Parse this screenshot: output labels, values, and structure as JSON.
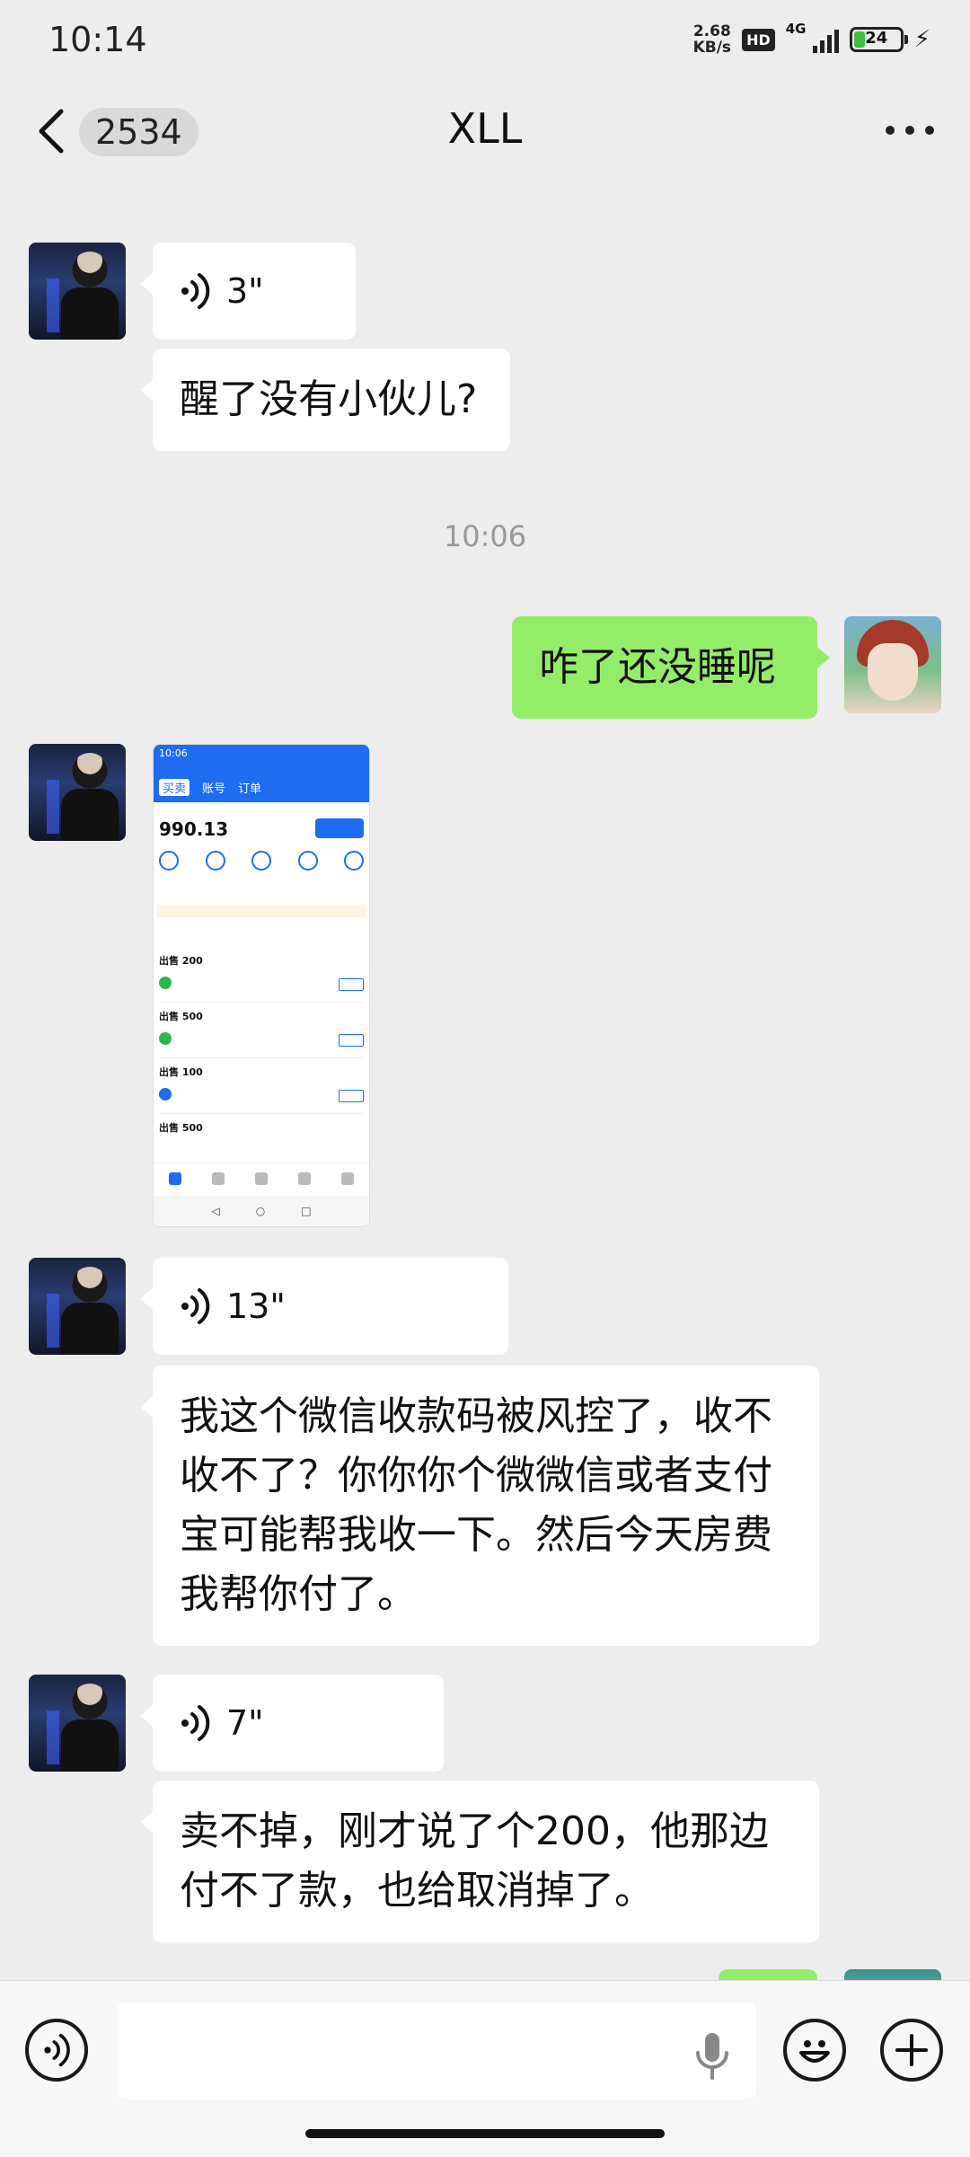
{
  "status_bar": {
    "time": "10:14",
    "net_speed_value": "2.68",
    "net_speed_unit": "KB/s",
    "hd_label": "HD",
    "network_type": "4G",
    "battery_percent": "24"
  },
  "nav": {
    "unread_count": "2534",
    "title": "XLL"
  },
  "messages": [
    {
      "side": "left",
      "type": "voice",
      "duration": "3\""
    },
    {
      "side": "left",
      "type": "text",
      "text": "醒了没有小伙儿?"
    },
    {
      "type": "timestamp",
      "text": "10:06"
    },
    {
      "side": "right",
      "type": "text",
      "text": "咋了还没睡呢"
    },
    {
      "side": "left",
      "type": "image",
      "image_content": {
        "status_time": "10:06",
        "tabs": [
          "买卖",
          "账号",
          "订单"
        ],
        "balance": "990.13",
        "rows": [
          {
            "amount": "出售 200",
            "status": "已取消"
          },
          {
            "amount": "出售 500",
            "status": "已取消"
          },
          {
            "amount": "出售 100",
            "status": "已取消"
          },
          {
            "amount": "出售 500",
            "status": ""
          }
        ]
      }
    },
    {
      "side": "left",
      "type": "voice",
      "duration": "13\""
    },
    {
      "side": "left",
      "type": "text",
      "text": "我这个微信收款码被风控了，收不收不了？你你你个微微信或者支付宝可能帮我收一下。然后今天房费我帮你付了。"
    },
    {
      "side": "left",
      "type": "voice",
      "duration": "7\""
    },
    {
      "side": "left",
      "type": "text",
      "text": "卖不掉，刚才说了个200，他那边付不了款，也给取消掉了。"
    }
  ],
  "input_bar": {
    "placeholder": ""
  },
  "colors": {
    "background": "#ededed",
    "outgoing_bubble": "#95ec69",
    "incoming_bubble": "#ffffff",
    "timestamp_text": "#999999"
  },
  "icons": [
    "back-arrow-icon",
    "more-icon",
    "voice-wave-icon",
    "microphone-icon",
    "emoji-icon",
    "plus-icon",
    "voice-toggle-icon"
  ]
}
